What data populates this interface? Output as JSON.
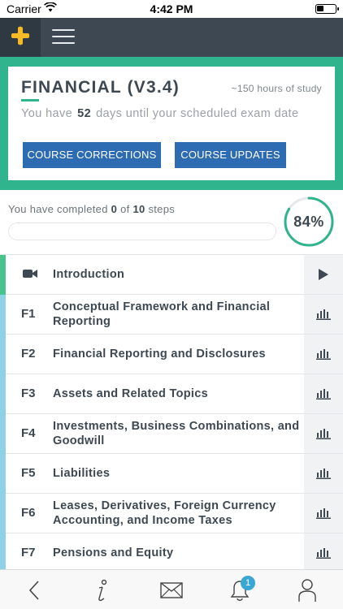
{
  "status_bar": {
    "carrier": "Carrier",
    "time": "4:42 PM"
  },
  "header": {
    "logo_icon": "plus-icon",
    "menu_icon": "hamburger-icon"
  },
  "course": {
    "title": "FINANCIAL (V3.4)",
    "study_hours": "~150 hours of study",
    "days_prefix": "You have",
    "days_count": "52",
    "days_suffix": "days until your scheduled exam date",
    "buttons": {
      "corrections": "COURSE CORRECTIONS",
      "updates": "COURSE UPDATES"
    }
  },
  "progress": {
    "prefix": "You have completed",
    "completed": "0",
    "of_word": "of",
    "total": "10",
    "suffix": "steps",
    "percent_label": "84%",
    "percent_value": 0.84,
    "steps_fraction": 0.0
  },
  "topics": [
    {
      "code": "",
      "label": "Introduction",
      "icon": "video-icon",
      "action_icon": "play-icon"
    },
    {
      "code": "F1",
      "label": "Conceptual Framework and Financial Reporting",
      "action_icon": "bar-chart-icon"
    },
    {
      "code": "F2",
      "label": "Financial Reporting and Disclosures",
      "action_icon": "bar-chart-icon"
    },
    {
      "code": "F3",
      "label": "Assets and Related Topics",
      "action_icon": "bar-chart-icon"
    },
    {
      "code": "F4",
      "label": "Investments, Business Combinations, and Goodwill",
      "action_icon": "bar-chart-icon"
    },
    {
      "code": "F5",
      "label": "Liabilities",
      "action_icon": "bar-chart-icon"
    },
    {
      "code": "F6",
      "label": "Leases, Derivatives, Foreign Currency Accounting, and Income Taxes",
      "action_icon": "bar-chart-icon"
    },
    {
      "code": "F7",
      "label": "Pensions and Equity",
      "action_icon": "bar-chart-icon"
    }
  ],
  "tab_bar": {
    "items": [
      "back-icon",
      "info-icon",
      "mail-icon",
      "bell-icon",
      "user-icon"
    ],
    "notification_count": "1"
  },
  "colors": {
    "accent_green": "#2fb48e",
    "header_dark": "#3d4852",
    "button_blue": "#2d6bb3",
    "logo_yellow": "#f6b928",
    "topic_bar_blue": "#8fd1e6",
    "topic_bar_green": "#45c48c",
    "badge_blue": "#3aa6d4"
  }
}
